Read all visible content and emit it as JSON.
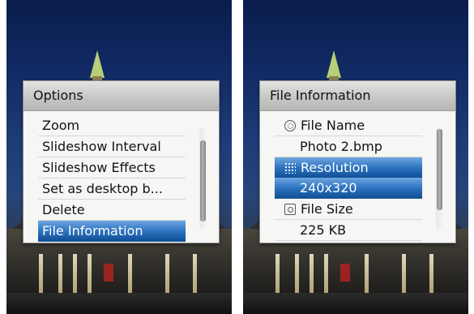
{
  "options_menu": {
    "title": "Options",
    "items": [
      {
        "label": "Zoom"
      },
      {
        "label": "Slideshow Interval"
      },
      {
        "label": "Slideshow Effects"
      },
      {
        "label": "Set as desktop b..."
      },
      {
        "label": "Delete"
      },
      {
        "label": "File Information"
      }
    ],
    "selected_index": 5,
    "scroll_position": 0.65
  },
  "file_info": {
    "title": "File Information",
    "file_name_label": "File Name",
    "file_name_value": "Photo 2.bmp",
    "resolution_label": "Resolution",
    "resolution_value": "240x320",
    "file_size_label": "File Size",
    "file_size_value": "225 KB",
    "icons": {
      "file_name": "film-reel-icon",
      "resolution": "pixel-grid-icon",
      "file_size": "disk-icon"
    },
    "scroll_position": 0.0
  },
  "theme": {
    "selection_color": "#2e74c0",
    "panel_color": "#f6f6f4",
    "header_color": "#c7c7c5"
  }
}
